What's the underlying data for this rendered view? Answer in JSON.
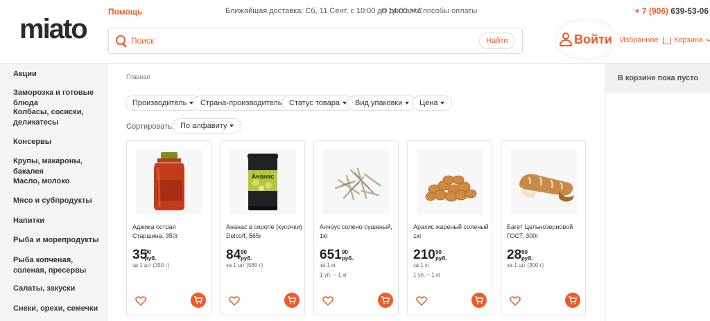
{
  "brand": {
    "logo_text": "miato",
    "accent": "#f05a28"
  },
  "topbar": {
    "help": "Помощь",
    "delivery": "Ближайшая доставка: Сб, 11 Сент, с 10:00 до 14:00",
    "about_delivery": "О доставке",
    "payment": "Способы оплаты",
    "phone_code": "+ 7 (906)",
    "phone_rest": "639-53-06"
  },
  "search": {
    "placeholder": "Поиск",
    "button": "Найти"
  },
  "account": {
    "login": "Войти",
    "favorites": "Избранное",
    "cart": "Корзина"
  },
  "sidebar": {
    "categories": [
      "Акции",
      "Заморозка и готовые блюда",
      "Колбасы, сосиски, деликатесы",
      "Консервы",
      "Крупы, макароны, бакалея",
      "Масло, молоко",
      "Мясо и субпродукты",
      "Напитки",
      "Рыба и морепродукты",
      "Рыба копченая, соленая, пресервы",
      "Салаты, закуски",
      "Снеки, орехи, семечки"
    ]
  },
  "breadcrumb": "Главная",
  "filters": [
    "Производитель",
    "Страна-производитель",
    "Статус товара",
    "Вид упаковки",
    "Цена"
  ],
  "sort": {
    "label": "Сортировать:",
    "value": "По алфавиту"
  },
  "cart_panel": {
    "empty_text": "В корзине пока пусто"
  },
  "products": [
    {
      "name": "Аджика острая Старшина, 350г",
      "price_int": "35",
      "price_cents": "90",
      "currency": "руб.",
      "unit": "за 1 шт (350 г)",
      "unit2": "",
      "image": "jar-adjika"
    },
    {
      "name": "Ананас в сиропе (кусочки) Delcoff, 565г",
      "price_int": "84",
      "price_cents": "90",
      "currency": "руб.",
      "unit": "за 1 шт (565 г)",
      "unit2": "",
      "image": "can-pineapple",
      "can_label": "Ананас"
    },
    {
      "name": "Анчоус солено-сушеный, 1кг",
      "price_int": "651",
      "price_cents": "90",
      "currency": "руб.",
      "unit": "за 1 кг",
      "unit2": "1 уп. ~ 1 кг",
      "image": "dried-anchovy"
    },
    {
      "name": "Арахис жареный соленый 1кг",
      "price_int": "210",
      "price_cents": "90",
      "currency": "руб.",
      "unit": "за 1 кг",
      "unit2": "1 уп. ~ 1 кг",
      "image": "peanuts"
    },
    {
      "name": "Багет Цельнозерновой ГОСТ, 300г",
      "price_int": "28",
      "price_cents": "90",
      "currency": "руб.",
      "unit": "за 1 шт (300 г)",
      "unit2": "",
      "image": "baguette"
    }
  ]
}
